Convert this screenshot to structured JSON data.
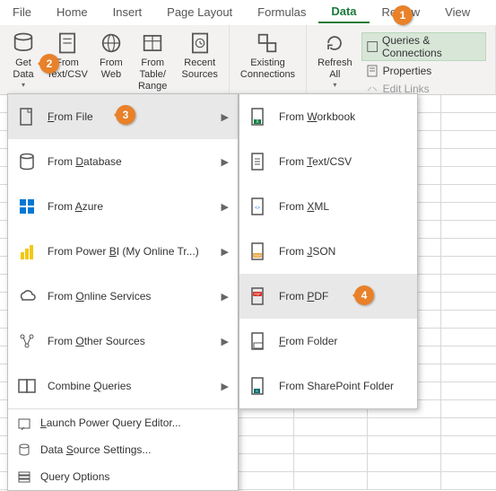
{
  "ribbon": {
    "tabs": [
      "File",
      "Home",
      "Insert",
      "Page Layout",
      "Formulas",
      "Data",
      "Review",
      "View"
    ],
    "active_tab": "Data",
    "buttons": {
      "get_data": "Get\nData",
      "from_textcsv": "From\nText/CSV",
      "from_web": "From\nWeb",
      "from_tablerange": "From Table/\nRange",
      "recent_sources": "Recent\nSources",
      "existing_conn": "Existing\nConnections",
      "refresh_all": "Refresh\nAll"
    },
    "right": {
      "queries": "Queries & Connections",
      "properties": "Properties",
      "edit_links": "Edit Links"
    }
  },
  "menu1": {
    "items": [
      {
        "label": "From File",
        "arrow": true,
        "hl": true,
        "icon": "file-icon",
        "u": "F"
      },
      {
        "label": "From Database",
        "arrow": true,
        "icon": "database-icon",
        "u": "D"
      },
      {
        "label": "From Azure",
        "arrow": true,
        "icon": "azure-icon",
        "u": "A"
      },
      {
        "label": "From Power BI (My Online Tr...)",
        "arrow": true,
        "icon": "powerbi-icon",
        "u": "B"
      },
      {
        "label": "From Online Services",
        "arrow": true,
        "icon": "online-services-icon",
        "u": "O"
      },
      {
        "label": "From Other Sources",
        "arrow": true,
        "icon": "other-sources-icon",
        "u": "O"
      },
      {
        "label": "Combine Queries",
        "arrow": true,
        "icon": "combine-icon",
        "u": "Q"
      }
    ],
    "small": [
      {
        "label": "Launch Power Query Editor...",
        "icon": "launch-editor-icon",
        "u": "L"
      },
      {
        "label": "Data Source Settings...",
        "icon": "data-source-icon",
        "u": "S"
      },
      {
        "label": "Query Options",
        "icon": "query-options-icon",
        "u": "P"
      }
    ]
  },
  "menu2": {
    "items": [
      {
        "label": "From Workbook",
        "icon": "workbook-icon",
        "u": "W"
      },
      {
        "label": "From Text/CSV",
        "icon": "textcsv-icon",
        "u": "T"
      },
      {
        "label": "From XML",
        "icon": "xml-icon",
        "u": "X"
      },
      {
        "label": "From JSON",
        "icon": "json-icon",
        "u": "J"
      },
      {
        "label": "From PDF",
        "icon": "pdf-icon",
        "u": "P",
        "hl": true
      },
      {
        "label": "From Folder",
        "icon": "folder-icon",
        "u": "F"
      },
      {
        "label": "From SharePoint Folder",
        "icon": "sharepoint-icon",
        "u": "O"
      }
    ]
  },
  "badges": {
    "1": "1",
    "2": "2",
    "3": "3",
    "4": "4"
  }
}
